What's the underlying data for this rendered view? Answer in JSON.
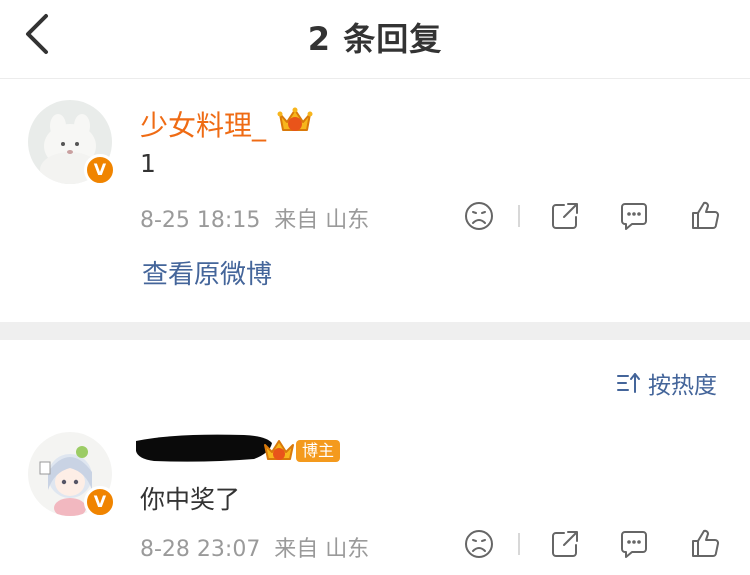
{
  "header": {
    "title": "2 条回复"
  },
  "root_comment": {
    "username": "少女料理_",
    "text": "1",
    "meta": "8-25 18:15  来自 山东",
    "view_original": "查看原微博"
  },
  "sort": {
    "label": "按热度"
  },
  "reply": {
    "badge": "博主",
    "text": "你中奖了",
    "meta": "8-28 23:07  来自 山东"
  },
  "icons": {
    "back": "chevron-left-icon",
    "dislike": "frown-face-icon",
    "share": "share-icon",
    "comment": "comment-bubble-icon",
    "like": "thumbs-up-icon",
    "crown": "crown-icon",
    "sort": "sort-icon",
    "verified": "verified-v-icon"
  },
  "colors": {
    "username": "#ef6b14",
    "link": "#44659a",
    "verified_badge": "#f08400",
    "meta": "#9a9a9a"
  },
  "badge_letter": "V"
}
